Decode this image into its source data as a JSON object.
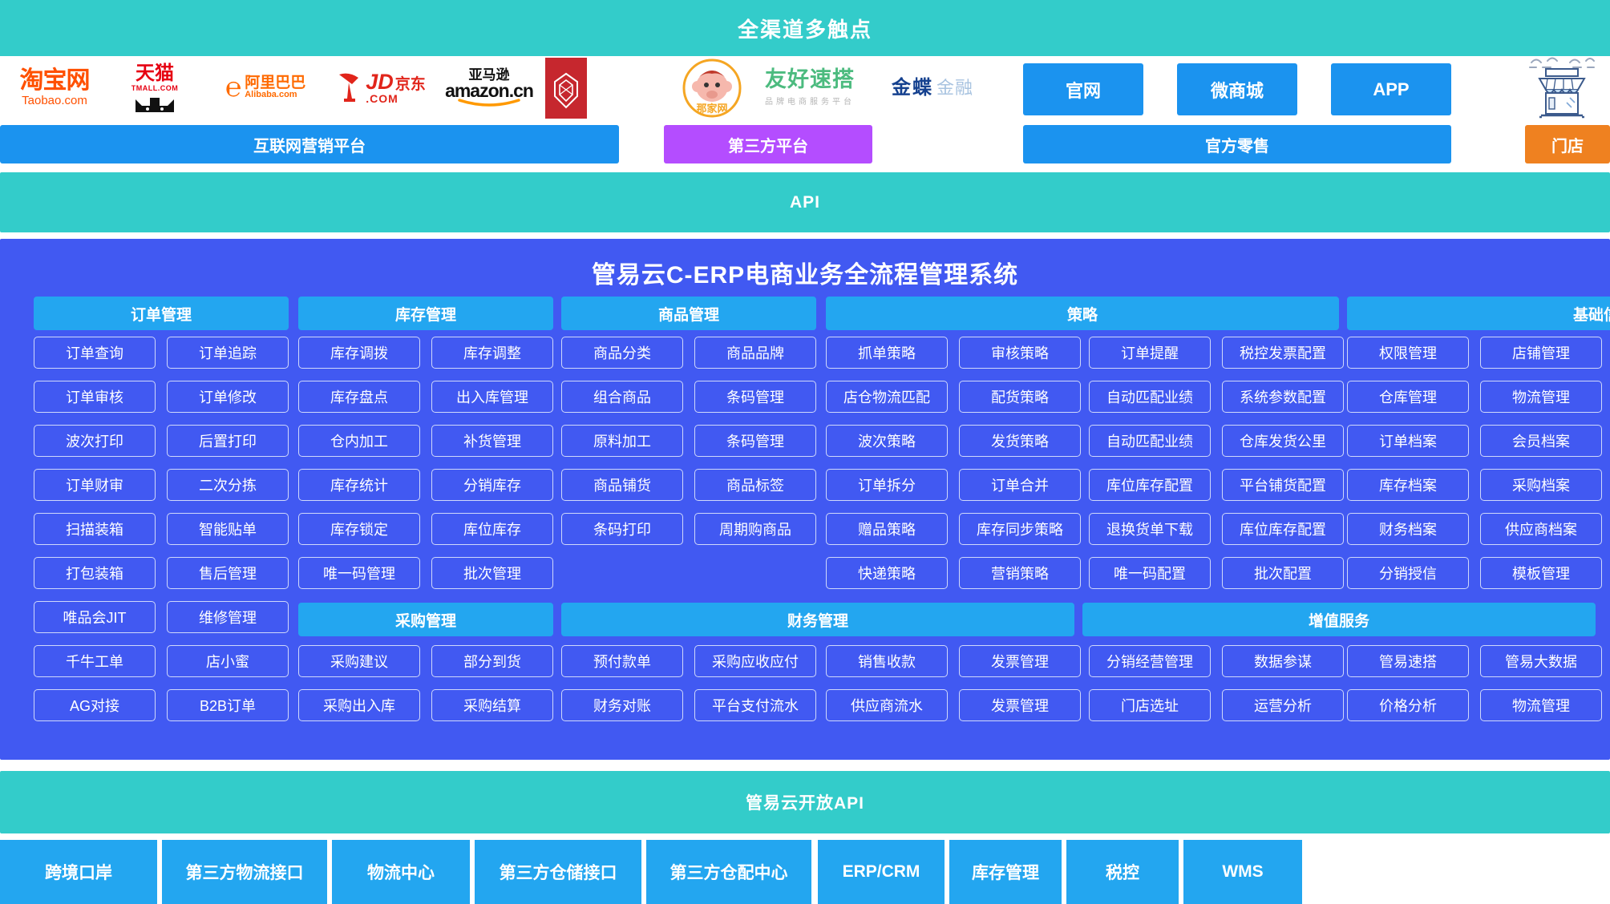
{
  "top_banner": {
    "title": "全渠道多触点"
  },
  "logos": {
    "taobao": {
      "cn": "淘宝网",
      "en": "Taobao.com"
    },
    "tmall": {
      "cn": "天猫",
      "en": "TMALL.COM"
    },
    "alibaba": {
      "cn": "阿里巴巴",
      "en": "Alibaba.com"
    },
    "jd": {
      "cn": "京东",
      "brand": "JD",
      "dom": ".COM"
    },
    "amazon": {
      "cn": "亚马逊",
      "en": "amazon",
      "suffix": ".cn"
    },
    "najiawang": {
      "cn": "那家网"
    },
    "youhao": {
      "cn": "友好速搭",
      "sub": "品牌电商服务平台"
    },
    "kingdee": {
      "a": "金蝶",
      "b": "金融"
    }
  },
  "channel_chips": [
    {
      "label": "官网",
      "name": "chip-official-site"
    },
    {
      "label": "微商城",
      "name": "chip-wechat-mall"
    },
    {
      "label": "APP",
      "name": "chip-app"
    }
  ],
  "category_bars": [
    {
      "label": "互联网营销平台",
      "color": "#1b93ef"
    },
    {
      "label": "第三方平台",
      "color": "#b44dff"
    },
    {
      "label": "官方零售",
      "color": "#1b93ef"
    },
    {
      "label": "门店",
      "color": "#ef8120"
    }
  ],
  "api_band": {
    "label": "API"
  },
  "main": {
    "title": "管易云C-ERP电商业务全流程管理系统",
    "section_headers": [
      {
        "label": "订单管理"
      },
      {
        "label": "库存管理"
      },
      {
        "label": "商品管理"
      },
      {
        "label": "策略"
      },
      {
        "label": "基础信息"
      },
      {
        "label": "采购管理"
      },
      {
        "label": "财务管理"
      },
      {
        "label": "增值服务"
      }
    ],
    "columns": {
      "order_c1": [
        "订单查询",
        "订单审核",
        "波次打印",
        "订单财审",
        "扫描装箱",
        "打包装箱",
        "唯品会JIT",
        "千牛工单",
        "AG对接"
      ],
      "order_c2": [
        "订单追踪",
        "订单修改",
        "后置打印",
        "二次分拣",
        "智能贴单",
        "售后管理",
        "维修管理",
        "店小蜜",
        "B2B订单"
      ],
      "stock_c1": [
        "库存调拨",
        "库存盘点",
        "仓内加工",
        "库存统计",
        "库存锁定",
        "唯一码管理"
      ],
      "stock_c2": [
        "库存调整",
        "出入库管理",
        "补货管理",
        "分销库存",
        "库位库存",
        "批次管理"
      ],
      "purchase_c1": [
        "采购建议",
        "采购出入库"
      ],
      "purchase_c2": [
        "部分到货",
        "采购结算"
      ],
      "goods_c1": [
        "商品分类",
        "组合商品",
        "原料加工",
        "商品铺货",
        "条码打印"
      ],
      "goods_c2": [
        "商品品牌",
        "条码管理",
        "条码管理",
        "商品标签",
        "周期购商品"
      ],
      "finance_c1": [
        "预付款单",
        "财务对账"
      ],
      "finance_c2": [
        "采购应收应付",
        "平台支付流水"
      ],
      "finance_c3": [
        "销售收款",
        "供应商流水"
      ],
      "finance_c4": [
        "发票管理",
        "发票管理"
      ],
      "strategy_c1": [
        "抓单策略",
        "店仓物流匹配",
        "波次策略",
        "订单拆分",
        "赠品策略",
        "快递策略"
      ],
      "strategy_c2": [
        "审核策略",
        "配货策略",
        "发货策略",
        "订单合并",
        "库存同步策略",
        "营销策略"
      ],
      "strategy_c3": [
        "订单提醒",
        "自动匹配业绩",
        "自动匹配业绩",
        "库位库存配置",
        "退换货单下载",
        "唯一码配置"
      ],
      "strategy_c4": [
        "税控发票配置",
        "系统参数配置",
        "仓库发货公里",
        "平台铺货配置",
        "库位库存配置",
        "批次配置"
      ],
      "vas_c1": [
        "分销经营管理",
        "门店选址"
      ],
      "vas_c2": [
        "数据参谋",
        "运营分析"
      ],
      "basic_c1": [
        "权限管理",
        "仓库管理",
        "订单档案",
        "库存档案",
        "财务档案",
        "分销授信"
      ],
      "basic_c2": [
        "店铺管理",
        "物流管理",
        "会员档案",
        "采购档案",
        "供应商档案",
        "模板管理"
      ],
      "vas_c3": [
        "管易速搭",
        "价格分析"
      ],
      "vas_c4": [
        "管易大数据",
        "物流管理"
      ]
    }
  },
  "open_api_band": {
    "label": "管易云开放API"
  },
  "footer_chips": [
    {
      "label": "跨境口岸"
    },
    {
      "label": "第三方物流接口"
    },
    {
      "label": "物流中心"
    },
    {
      "label": "第三方仓储接口"
    },
    {
      "label": "第三方仓配中心"
    },
    {
      "label": "ERP/CRM"
    },
    {
      "label": "库存管理"
    },
    {
      "label": "税控"
    },
    {
      "label": "WMS"
    }
  ],
  "colors": {
    "teal": "#33ccca",
    "blue_panel": "#4159f2",
    "blue_chip": "#1b93ef",
    "section_header": "#23a6f0",
    "purple": "#b44dff",
    "orange": "#ef8120"
  }
}
